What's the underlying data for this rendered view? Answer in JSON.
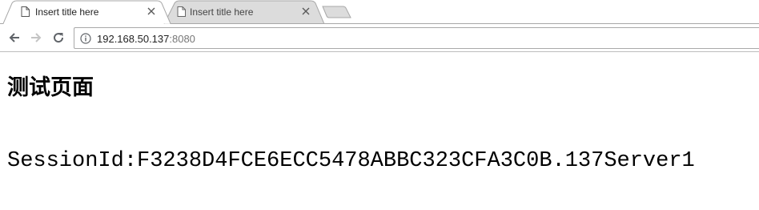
{
  "tabs": [
    {
      "title": "Insert title here",
      "active": true
    },
    {
      "title": "Insert title here",
      "active": false
    }
  ],
  "address_bar": {
    "host": "192.168.50.137",
    "port": ":8080"
  },
  "page": {
    "heading": "测试页面",
    "session_label": "SessionId:",
    "session_value": "F3238D4FCE6ECC5478ABBC323CFA3C0B.137Server1"
  },
  "colors": {
    "tab_active_bg": "#ffffff",
    "tab_inactive_bg": "#dcdcdc",
    "tab_border": "#a8a8a8",
    "url_port": "#777777"
  },
  "icons": {
    "page_favicon": "document-icon",
    "close": "close-icon",
    "back": "arrow-left-icon",
    "forward": "arrow-right-icon",
    "reload": "reload-icon",
    "info": "info-icon"
  }
}
